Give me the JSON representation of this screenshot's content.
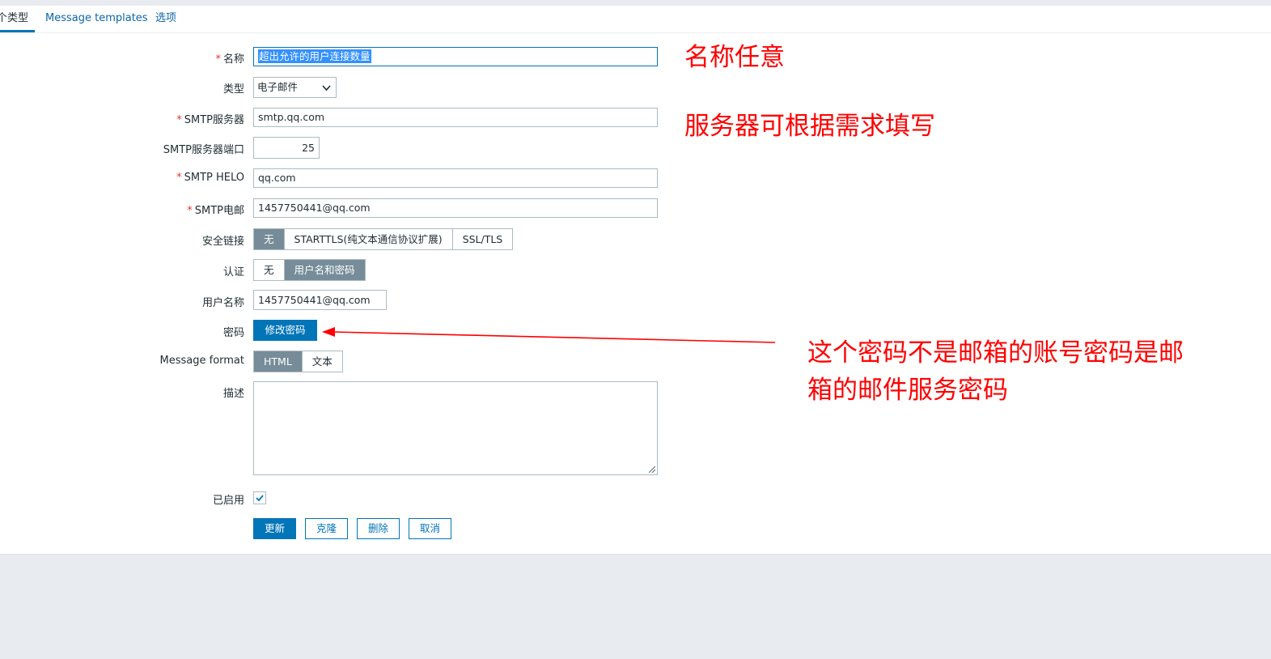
{
  "tabs": [
    {
      "label": "个类型"
    },
    {
      "label": "Message templates"
    },
    {
      "label": "选项"
    }
  ],
  "form": {
    "name": {
      "label": "名称",
      "value": "超出允许的用户连接数量"
    },
    "type": {
      "label": "类型",
      "value": "电子邮件"
    },
    "smtp_server": {
      "label": "SMTP服务器",
      "value": "smtp.qq.com"
    },
    "smtp_port": {
      "label": "SMTP服务器端口",
      "value": "25"
    },
    "smtp_helo": {
      "label": "SMTP HELO",
      "value": "qq.com"
    },
    "smtp_email": {
      "label": "SMTP电邮",
      "value": "1457750441@qq.com"
    },
    "security": {
      "label": "安全链接",
      "options": [
        "无",
        "STARTTLS(纯文本通信协议扩展)",
        "SSL/TLS"
      ],
      "selected": "无"
    },
    "auth": {
      "label": "认证",
      "options": [
        "无",
        "用户名和密码"
      ],
      "selected": "用户名和密码"
    },
    "username": {
      "label": "用户名称",
      "value": "1457750441@qq.com"
    },
    "password": {
      "label": "密码",
      "button": "修改密码"
    },
    "message_format": {
      "label": "Message format",
      "options": [
        "HTML",
        "文本"
      ],
      "selected": "HTML"
    },
    "description": {
      "label": "描述",
      "value": ""
    },
    "enabled": {
      "label": "已启用",
      "checked": true
    }
  },
  "buttons": {
    "update": "更新",
    "clone": "克隆",
    "delete": "删除",
    "cancel": "取消"
  },
  "annotations": {
    "name_note": "名称任意",
    "server_note": "服务器可根据需求填写",
    "password_note_line1": "这个密码不是邮箱的账号密码是邮",
    "password_note_line2": "箱的邮件服务密码"
  },
  "colors": {
    "accent": "#0275b8",
    "segment_on": "#768d99",
    "annotation": "#ff0000",
    "required": "#e33734"
  },
  "icons": {
    "dropdown": "chevron-down-icon",
    "checkbox": "check-icon",
    "arrow": "arrow-left-icon"
  }
}
